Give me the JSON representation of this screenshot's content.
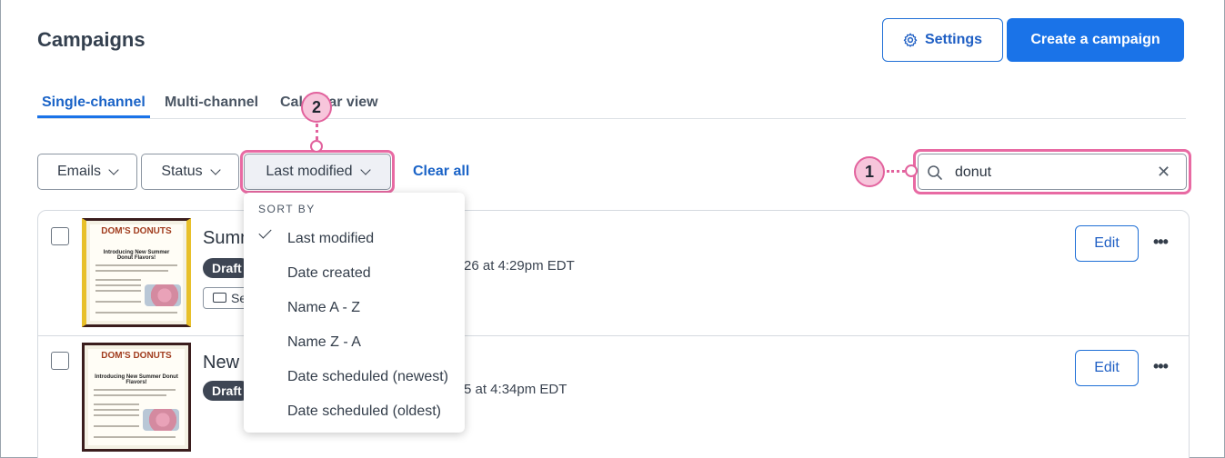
{
  "page": {
    "title": "Campaigns",
    "settings_label": "Settings",
    "create_label": "Create a campaign"
  },
  "tabs": [
    {
      "label": "Single-channel",
      "active": true
    },
    {
      "label": "Multi-channel",
      "active": false
    },
    {
      "label": "Calendar view",
      "active": false
    }
  ],
  "filters": {
    "emails_label": "Emails",
    "status_label": "Status",
    "sort_label": "Last modified",
    "clear_all_label": "Clear all"
  },
  "search": {
    "value": "donut",
    "placeholder": ""
  },
  "callouts": {
    "one": "1",
    "two": "2"
  },
  "sort_menu": {
    "header": "SORT BY",
    "selected": "Last modified",
    "items": [
      "Last modified",
      "Date created",
      "Name A - Z",
      "Name Z - A",
      "Date scheduled (newest)",
      "Date scheduled (oldest)"
    ]
  },
  "campaigns": [
    {
      "title_visible": "Summ",
      "status": "Draft",
      "folder_visible": "Se",
      "meta_visible": "26 at 4:29pm EDT",
      "edit_label": "Edit",
      "thumb_logo": "DOM'S DONUTS",
      "thumb_heading": "Introducing New Summer Donut Flavors!"
    },
    {
      "title_visible": "New",
      "status": "Draft",
      "meta_visible": "5 at 4:34pm EDT",
      "edit_label": "Edit",
      "thumb_logo": "DOM'S DONUTS",
      "thumb_heading": "Introducing New Summer Donut Flavors!"
    }
  ],
  "colors": {
    "accent": "#1a73e8",
    "highlight": "#e2629d",
    "callout_fill": "#f7c5db",
    "draft_badge": "#3e4654"
  }
}
